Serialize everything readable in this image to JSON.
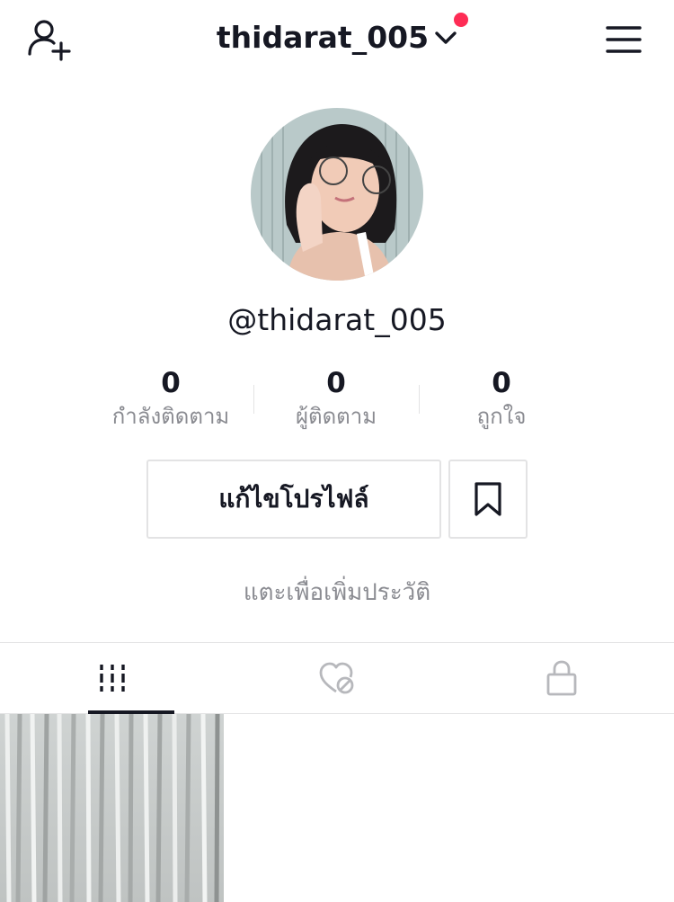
{
  "header": {
    "username_title": "thidarat_005",
    "add_user_icon": "add-user-icon",
    "menu_icon": "hamburger-menu-icon",
    "notification_color": "#fe2c55"
  },
  "profile": {
    "handle": "@thidarat_005",
    "avatar_icon": "profile-photo"
  },
  "stats": [
    {
      "value": "0",
      "label": "กำลังติดตาม"
    },
    {
      "value": "0",
      "label": "ผู้ติดตาม"
    },
    {
      "value": "0",
      "label": "ถูกใจ"
    }
  ],
  "actions": {
    "edit_profile_label": "แก้ไขโปรไฟล์",
    "bookmark_icon": "bookmark-icon"
  },
  "bio": {
    "placeholder": "แตะเพื่อเพิ่มประวัติ"
  },
  "tabs": [
    {
      "icon": "grid-videos-icon",
      "active": true
    },
    {
      "icon": "liked-hidden-heart-icon",
      "active": false
    },
    {
      "icon": "lock-icon",
      "active": false
    }
  ],
  "videos": [
    {
      "thumbnail": "curtain-video-thumbnail"
    }
  ],
  "colors": {
    "text_primary": "#161823",
    "text_secondary": "#8a8b91",
    "border": "#e3e3e4",
    "accent": "#fe2c55"
  }
}
